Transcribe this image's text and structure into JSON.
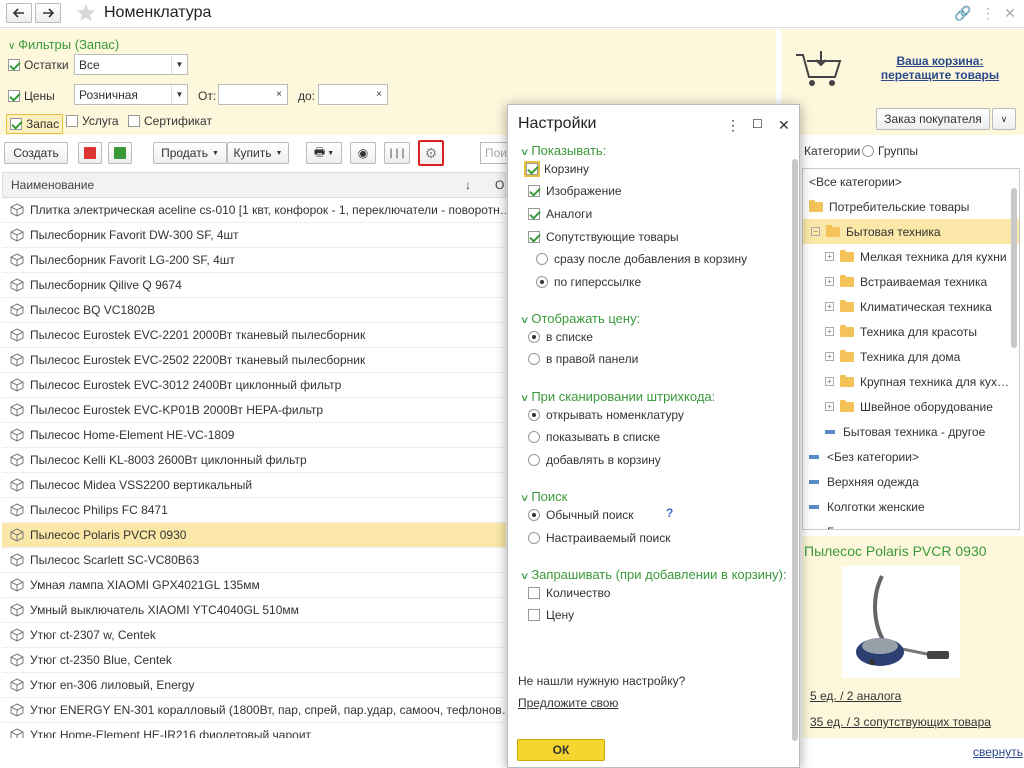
{
  "window": {
    "title": "Номенклатура"
  },
  "filters": {
    "header": "Фильтры (Запас)",
    "stock_label": "Остатки",
    "stock_value": "Все",
    "prices_label": "Цены",
    "prices_value": "Розничная",
    "from_label": "От:",
    "to_label": "до:",
    "stock_cb": "Запас",
    "service_cb": "Услуга",
    "cert_cb": "Сертификат"
  },
  "cart": {
    "line1": "Ваша корзина:",
    "line2": "перетащите товары",
    "order_button": "Заказ покупателя"
  },
  "toolbar": {
    "create": "Создать",
    "sell": "Продать",
    "buy": "Купить",
    "search_placeholder": "Поиск"
  },
  "grid": {
    "col_name": "Наименование",
    "col2": "О",
    "rows": [
      "Плитка электрическая aceline cs-010 [1 квт, конфорок - 1, переключатели - поворотн…",
      "Пылесборник Favorit DW-300 SF, 4шт",
      "Пылесборник Favorit LG-200 SF, 4шт",
      "Пылесборник Qilive Q 9674",
      "Пылесос BQ VC1802B",
      "Пылесос Eurostek EVC-2201 2000Вт тканевый пылесборник",
      "Пылесос Eurostek EVC-2502 2200Вт тканевый пылесборник",
      "Пылесос Eurostek EVC-3012 2400Вт циклонный фильтр",
      "Пылесос Eurostek EVC-KP01B 2000Вт HEPA-фильтр",
      "Пылесос Home-Element HE-VC-1809",
      "Пылесос Kelli KL-8003 2600Вт циклонный фильтр",
      "Пылесос Midea VSS2200 вертикальный",
      "Пылесос Philips FC 8471",
      "Пылесос Polaris PVCR 0930",
      "Пылесос Scarlett SC-VC80B63",
      "Умная лампа XIAOMI GPX4021GL 135мм",
      "Умный выключатель XIAOMI YTC4040GL 510мм",
      "Утюг ct-2307 w, Centek",
      "Утюг ct-2350 Blue, Centek",
      "Утюг en-306 лиловый, Energy",
      "Утюг ENERGY EN-301 коралловый (1800Вт, пар, спрей, пар.удар, самооч, тефлонов…",
      "Утюг Home-Element HE-IR216 фиолетовый чароит"
    ],
    "selected_index": 13
  },
  "dialog": {
    "title": "Настройки",
    "show_header": "Показывать:",
    "show_cart": "Корзину",
    "show_image": "Изображение",
    "show_analogs": "Аналоги",
    "show_related": "Сопутствующие товары",
    "after_add": "сразу после добавления в корзину",
    "by_link": "по гиперссылке",
    "price_header": "Отображать цену:",
    "in_list": "в списке",
    "in_right_panel": "в правой панели",
    "scan_header": "При сканировании штрихкода:",
    "open_item": "открывать номенклатуру",
    "show_in_list": "показывать в списке",
    "add_to_cart": "добавлять в корзину",
    "search_header": "Поиск",
    "simple_search": "Обычный поиск",
    "help": "?",
    "custom_search": "Настраиваемый поиск",
    "ask_header": "Запрашивать (при добавлении в корзину):",
    "quantity": "Количество",
    "price": "Цену",
    "not_found": "Не нашли нужную настройку?",
    "suggest": "Предложите свою",
    "ok": "ОК"
  },
  "right": {
    "radio_categories": "Категории",
    "radio_groups": "Группы",
    "tree": [
      {
        "label": "<Все категории>",
        "level": 0,
        "type": "none"
      },
      {
        "label": "Потребительские товары",
        "level": 0,
        "type": "folder"
      },
      {
        "label": "Бытовая техника",
        "level": 1,
        "type": "folder-open",
        "selected": true
      },
      {
        "label": "Мелкая техника для кухни",
        "level": 2,
        "type": "folder-plus"
      },
      {
        "label": "Встраиваемая техника",
        "level": 2,
        "type": "folder-plus"
      },
      {
        "label": "Климатическая техника",
        "level": 2,
        "type": "folder-plus"
      },
      {
        "label": "Техника для красоты",
        "level": 2,
        "type": "folder-plus"
      },
      {
        "label": "Техника для дома",
        "level": 2,
        "type": "folder-plus"
      },
      {
        "label": "Крупная техника для кух…",
        "level": 2,
        "type": "folder-plus"
      },
      {
        "label": "Швейное оборудование",
        "level": 2,
        "type": "folder-plus"
      },
      {
        "label": "Бытовая техника - другое",
        "level": 2,
        "type": "dash"
      },
      {
        "label": "<Без категории>",
        "level": 0,
        "type": "dash"
      },
      {
        "label": "Верхняя одежда",
        "level": 0,
        "type": "dash"
      },
      {
        "label": "Колготки женские",
        "level": 0,
        "type": "dash"
      },
      {
        "label": "Бюстгальтеры",
        "level": 0,
        "type": "dash"
      }
    ],
    "product_title": "Пылесос Polaris PVCR 0930",
    "analogs_link": "5 ед. / 2 аналога",
    "related_link": "35 ед. / 3 сопутствующих товара",
    "collapse": "свернуть"
  }
}
